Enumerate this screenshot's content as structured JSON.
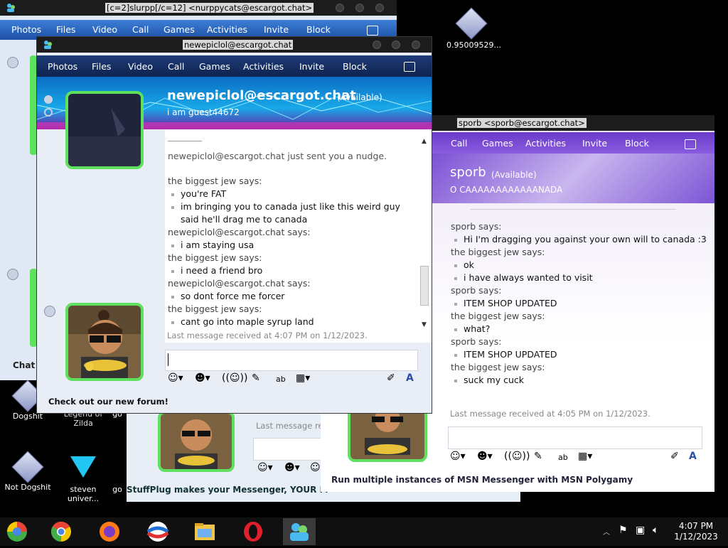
{
  "desktop": {
    "icons": [
      {
        "label": "0.95009529..."
      },
      {
        "label": "Dogshit"
      },
      {
        "label": "Legend of Zilda"
      },
      {
        "label": "Not Dogshit"
      },
      {
        "label": "steven univer..."
      },
      {
        "label": "go"
      },
      {
        "label": "go"
      }
    ]
  },
  "window_back": {
    "title": "[c=2]slurpp[/c=12] <nurppycats@escargot.chat>",
    "menu": [
      "Photos",
      "Files",
      "Video",
      "Call",
      "Games",
      "Activities",
      "Invite",
      "Block"
    ],
    "chat_label": "Chat"
  },
  "window_front": {
    "title": "newepiclol@escargot.chat",
    "menu": [
      "Photos",
      "Files",
      "Video",
      "Call",
      "Games",
      "Activities",
      "Invite",
      "Block"
    ],
    "contact_name": "newepiclol@escargot.chat",
    "contact_status": "(Available)",
    "contact_message": "i am guest44672",
    "nudge": "newepiclol@escargot.chat just sent you a nudge.",
    "messages": [
      {
        "who": "the biggest jew says:",
        "lines": [
          "you're FAT",
          "im bringing you to canada just like this weird guy said he'll drag me to canada"
        ]
      },
      {
        "who": "newepiclol@escargot.chat says:",
        "lines": [
          "i am staying usa"
        ]
      },
      {
        "who": "the biggest jew says:",
        "lines": [
          "i need a friend bro"
        ]
      },
      {
        "who": "newepiclol@escargot.chat says:",
        "lines": [
          "so dont force me forcer"
        ]
      },
      {
        "who": "the biggest jew says:",
        "lines": [
          "cant go into maple syrup land"
        ]
      }
    ],
    "last_message": "Last message received at 4:07 PM on 1/12/2023.",
    "footer_link": "Check out our new forum!"
  },
  "window_mid": {
    "last_message_partial": "Last message re",
    "footer": "StuffPlug makes your Messenger, YOUR M"
  },
  "window_right": {
    "title": "sporb <sporb@escargot.chat>",
    "menu": [
      "Call",
      "Games",
      "Activities",
      "Invite",
      "Block"
    ],
    "contact_name": "sporb",
    "contact_status": "(Available)",
    "contact_message": "O CAAAAAAAAAAAANADA",
    "messages": [
      {
        "who": "sporb says:",
        "lines": [
          "Hi I'm dragging you against your own will to canada :3"
        ]
      },
      {
        "who": "the biggest jew says:",
        "lines": [
          "ok",
          "i have always wanted to visit"
        ]
      },
      {
        "who": "sporb says:",
        "lines": [
          "ITEM SHOP UPDATED"
        ]
      },
      {
        "who": "the biggest jew says:",
        "lines": [
          "what?"
        ]
      },
      {
        "who": "sporb says:",
        "lines": [
          "ITEM SHOP UPDATED"
        ]
      },
      {
        "who": "the biggest jew says:",
        "lines": [
          "suck my cuck"
        ]
      }
    ],
    "last_message": "Last message received at 4:05 PM on 1/12/2023.",
    "footer": "Run multiple instances of MSN Messenger with MSN Polygamy"
  },
  "taskbar": {
    "time": "4:07 PM",
    "date": "1/12/2023",
    "apps": [
      "chrome-alt-icon",
      "chrome-icon",
      "firefox-icon",
      "msn-globe-icon",
      "file-explorer-icon",
      "opera-icon",
      "messenger-icon"
    ]
  }
}
